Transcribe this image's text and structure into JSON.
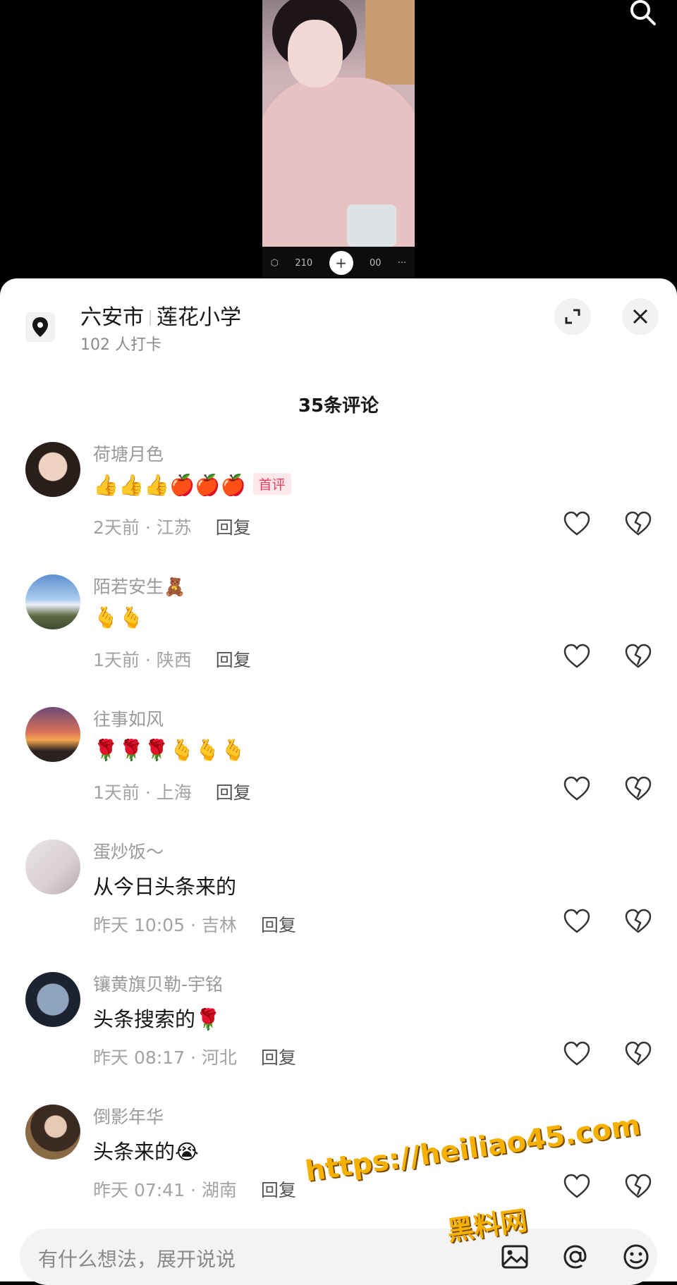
{
  "video": {
    "toolbar": {
      "left_count": "210",
      "right_count": "00",
      "more": "···",
      "plus": "+"
    }
  },
  "location": {
    "city": "六安市",
    "place": "莲花小学",
    "checkins": "102 人打卡"
  },
  "comments_header": {
    "title": "35条评论"
  },
  "comments": [
    {
      "name": "荷塘月色",
      "text": "👍👍👍🍎🍎🍎",
      "badge": "首评",
      "meta": "2天前 · 江苏",
      "reply": "回复"
    },
    {
      "name": "陌若安生🧸",
      "text": "🫰🫰",
      "meta": "1天前 · 陕西",
      "reply": "回复"
    },
    {
      "name": "往事如风",
      "text": "🌹🌹🌹🫰🫰🫰",
      "meta": "1天前 · 上海",
      "reply": "回复"
    },
    {
      "name": "蛋炒饭～",
      "text": "从今日头条来的",
      "meta": "昨天 10:05 · 吉林",
      "reply": "回复"
    },
    {
      "name": "镶黄旗贝勒-宇铭",
      "text": "头条搜索的🌹",
      "meta": "昨天 08:17 · 河北",
      "reply": "回复"
    },
    {
      "name": "倒影年华",
      "text": "头条来的😭",
      "meta": "昨天 07:41 · 湖南",
      "reply": "回复"
    }
  ],
  "input": {
    "placeholder": "有什么想法，展开说说"
  },
  "watermark": {
    "url": "https://heiliao45.com",
    "name": "黑料网"
  },
  "icons": [
    "search-icon",
    "location-pin-icon",
    "expand-icon",
    "close-icon",
    "heart-icon",
    "broken-heart-icon",
    "image-icon",
    "at-icon",
    "emoji-icon"
  ]
}
